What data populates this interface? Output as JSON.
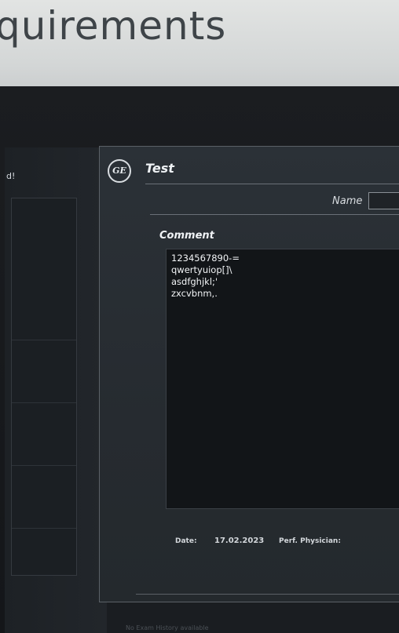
{
  "sign": {
    "text": "quirements"
  },
  "background": {
    "label": "d!"
  },
  "dialog": {
    "logo": "GE",
    "title": "Test",
    "name_label": "Name",
    "name_value": "",
    "comment_label": "Comment",
    "comment_lines": [
      "1234567890-=",
      "qwertyuiop[]\\",
      "asdfghjkl;'",
      "zxcvbnm,."
    ],
    "date_label": "Date:",
    "date_value": "17.02.2023",
    "physician_label": "Perf. Physician:"
  },
  "status_text": "No Exam History available"
}
